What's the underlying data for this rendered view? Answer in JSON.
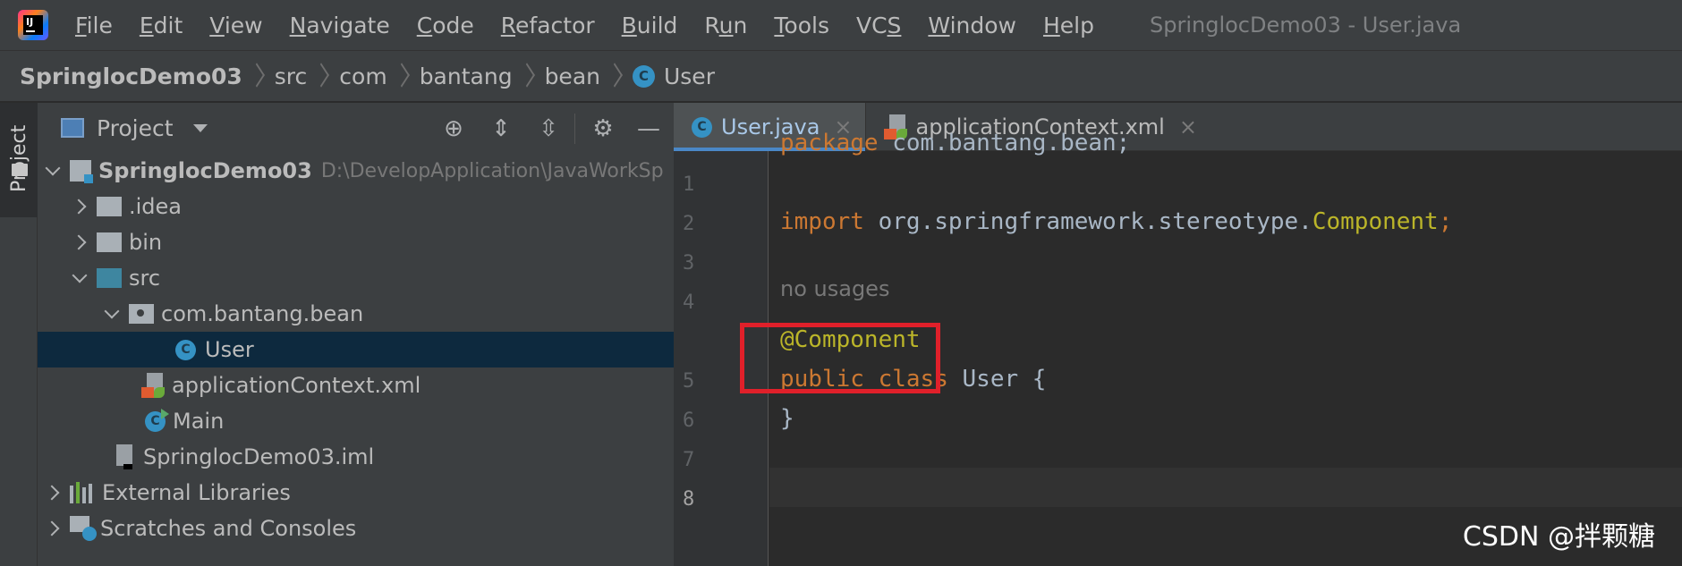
{
  "menubar": {
    "items": [
      {
        "pre": "",
        "u": "F",
        "post": "ile"
      },
      {
        "pre": "",
        "u": "E",
        "post": "dit"
      },
      {
        "pre": "",
        "u": "V",
        "post": "iew"
      },
      {
        "pre": "",
        "u": "N",
        "post": "avigate"
      },
      {
        "pre": "",
        "u": "C",
        "post": "ode"
      },
      {
        "pre": "",
        "u": "R",
        "post": "efactor"
      },
      {
        "pre": "",
        "u": "B",
        "post": "uild"
      },
      {
        "pre": "R",
        "u": "u",
        "post": "n"
      },
      {
        "pre": "",
        "u": "T",
        "post": "ools"
      },
      {
        "pre": "VC",
        "u": "S",
        "post": ""
      },
      {
        "pre": "",
        "u": "W",
        "post": "indow"
      },
      {
        "pre": "",
        "u": "H",
        "post": "elp"
      }
    ],
    "window_title": "SpringlocDemo03 - User.java"
  },
  "breadcrumb": {
    "project": "SpringlocDemo03",
    "parts": [
      "src",
      "com",
      "bantang",
      "bean"
    ],
    "file": "User"
  },
  "tool_stripe": {
    "project_label": "Project"
  },
  "project_panel": {
    "title": "Project",
    "tree": [
      {
        "label": "SpringlocDemo03",
        "path": "D:\\DevelopApplication\\JavaWorkSp"
      },
      {
        "label": ".idea"
      },
      {
        "label": "bin"
      },
      {
        "label": "src"
      },
      {
        "label": "com.bantang.bean"
      },
      {
        "label": "User"
      },
      {
        "label": "applicationContext.xml"
      },
      {
        "label": "Main"
      },
      {
        "label": "SpringlocDemo03.iml"
      },
      {
        "label": "External Libraries"
      },
      {
        "label": "Scratches and Consoles"
      }
    ]
  },
  "editor": {
    "tabs": [
      {
        "label": "User.java",
        "close": "×"
      },
      {
        "label": "applicationContext.xml",
        "close": "×"
      }
    ],
    "line_numbers": [
      "1",
      "2",
      "3",
      "4",
      "5",
      "6",
      "7",
      "8"
    ],
    "code": {
      "line1_kw": "package",
      "line1_rest": " com.bantang.bean;",
      "line3_kw": "import",
      "line3_rest": " org.springframework.stereotype.",
      "line3_ann": "Component",
      "line3_end": ";",
      "usages_hint": "no usages",
      "line5_ann": "@Component",
      "line6_kw1": "public",
      "line6_kw2": "class",
      "line6_rest": " User {",
      "line7": "}"
    }
  },
  "watermark": "CSDN @拌颗糖",
  "colors": {
    "keyword": "#cc7832",
    "annotation": "#bbb529",
    "highlight_box": "#e0202a",
    "selection": "#0d293e"
  }
}
